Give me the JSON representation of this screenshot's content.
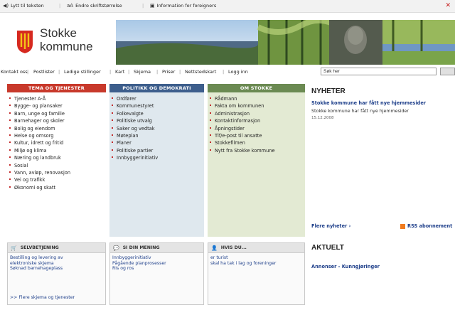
{
  "top_links": [
    {
      "label": "Lytt til teksten",
      "icon": "speaker-icon"
    },
    {
      "label": "Endre skriftstørrelse",
      "icon": "text-size-icon"
    },
    {
      "label": "Information for foreigners",
      "icon": "info-icon"
    }
  ],
  "brand": {
    "line1": "Stokke",
    "line2": "kommune"
  },
  "nav": [
    "Kontakt oss",
    "Postlister",
    "Ledige stillinger",
    "Kart",
    "Skjema",
    "Priser",
    "Nettstedskart",
    "Logg inn"
  ],
  "search": {
    "value": "Søk her"
  },
  "columns": [
    {
      "title": "TEMA OG TJENESTER",
      "color": "#c8392b",
      "items": [
        "Tjenester A-Å",
        "Bygge- og plansaker",
        "Barn, unge og familie",
        "Barnehager og skoler",
        "Bolig og eiendom",
        "Helse og omsorg",
        "Kultur, idrett og fritid",
        "Miljø og klima",
        "Næring og landbruk",
        "Sosial",
        "Vann, avløp, renovasjon",
        "Vei og trafikk",
        "Økonomi og skatt"
      ]
    },
    {
      "title": "POLITIKK OG DEMOKRATI",
      "color": "#3d5e8c",
      "items": [
        "Ordfører",
        "Kommunestyret",
        "Folkevalgte",
        "Politiske utvalg",
        "Saker og vedtak",
        "Møteplan",
        "Planer",
        "Politiske partier",
        "Innbyggerinitiativ"
      ]
    },
    {
      "title": "OM STOKKE",
      "color": "#6b8a52",
      "items": [
        "Rådmann",
        "Fakta om kommunen",
        "Administrasjon",
        "Kontaktinformasjon",
        "Åpningstider",
        "Tlf/e-post til ansatte",
        "Stokkefilmen",
        "Nytt fra Stokke kommune"
      ]
    }
  ],
  "news": {
    "title": "NYHETER",
    "headline": "Stokke kommune har fått nye hjemmesider",
    "text": "Stokke kommune har fått nye hjemmesider",
    "date": "15.12.2008",
    "more": "Flere nyheter ›",
    "rss": "RSS abonnement"
  },
  "boxes": [
    {
      "title": "SELVBETJENING",
      "icon": "cart-icon",
      "lines": [
        "Bestilling og levering av",
        "elektroniske skjema",
        "Søknad barnehageplass"
      ],
      "footer": ">> Flere skjema og tjenester"
    },
    {
      "title": "SI DIN MENING",
      "icon": "speech-bubble-icon",
      "lines": [
        "Innbyggerinitiativ",
        "Pågående planprosesser",
        "Ris og ros"
      ]
    },
    {
      "title": "HVIS DU...",
      "icon": "person-icon",
      "lines": [
        "er turist",
        "skal ha tak i lag og foreninger"
      ]
    }
  ],
  "aktuelt": {
    "title": "AKTUELT",
    "link": "Annonser - Kunngjøringer"
  }
}
